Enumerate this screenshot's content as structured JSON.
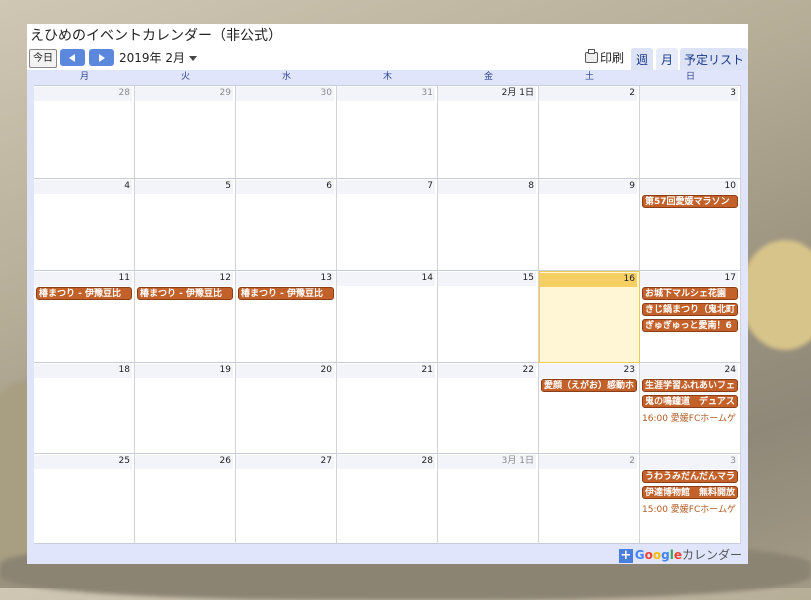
{
  "calendar": {
    "title": "えひめのイベントカレンダー（非公式）",
    "today_label": "今日",
    "current_date": "2019年 2月",
    "print_label": "印刷",
    "tabs": [
      "週",
      "月",
      "予定リスト"
    ],
    "weekdays": [
      "月",
      "火",
      "水",
      "木",
      "金",
      "土",
      "日"
    ],
    "weeks": [
      {
        "days": [
          {
            "label": "28",
            "other": true,
            "events": []
          },
          {
            "label": "29",
            "other": true,
            "events": []
          },
          {
            "label": "30",
            "other": true,
            "events": []
          },
          {
            "label": "31",
            "other": true,
            "events": []
          },
          {
            "label": "2月 1日",
            "other": false,
            "events": []
          },
          {
            "label": "2",
            "other": false,
            "events": []
          },
          {
            "label": "3",
            "other": false,
            "events": []
          }
        ]
      },
      {
        "days": [
          {
            "label": "4",
            "other": false,
            "events": []
          },
          {
            "label": "5",
            "other": false,
            "events": []
          },
          {
            "label": "6",
            "other": false,
            "events": []
          },
          {
            "label": "7",
            "other": false,
            "events": []
          },
          {
            "label": "8",
            "other": false,
            "events": []
          },
          {
            "label": "9",
            "other": false,
            "events": []
          },
          {
            "label": "10",
            "other": false,
            "events": [
              {
                "type": "bar",
                "text": "第57回愛媛マラソン"
              }
            ]
          }
        ]
      },
      {
        "days": [
          {
            "label": "11",
            "other": false,
            "events": [
              {
                "type": "bar",
                "text": "椿まつり - 伊豫豆比"
              }
            ]
          },
          {
            "label": "12",
            "other": false,
            "events": [
              {
                "type": "bar",
                "text": "椿まつり - 伊豫豆比"
              }
            ]
          },
          {
            "label": "13",
            "other": false,
            "events": [
              {
                "type": "bar",
                "text": "椿まつり - 伊豫豆比"
              }
            ]
          },
          {
            "label": "14",
            "other": false,
            "events": []
          },
          {
            "label": "15",
            "other": false,
            "events": []
          },
          {
            "label": "16",
            "other": false,
            "today": true,
            "events": []
          },
          {
            "label": "17",
            "other": false,
            "events": [
              {
                "type": "bar",
                "text": "お城下マルシェ花園"
              },
              {
                "type": "bar",
                "text": "きじ鍋まつり（鬼北町"
              },
              {
                "type": "bar",
                "text": "ぎゅぎゅっと愛南！6"
              }
            ]
          }
        ]
      },
      {
        "days": [
          {
            "label": "18",
            "other": false,
            "events": []
          },
          {
            "label": "19",
            "other": false,
            "events": []
          },
          {
            "label": "20",
            "other": false,
            "events": []
          },
          {
            "label": "21",
            "other": false,
            "events": []
          },
          {
            "label": "22",
            "other": false,
            "events": []
          },
          {
            "label": "23",
            "other": false,
            "events": [
              {
                "type": "bar",
                "text": "愛顔（えがお）感動ホ"
              }
            ]
          },
          {
            "label": "24",
            "other": false,
            "events": [
              {
                "type": "bar",
                "text": "生涯学習ふれあいフェ"
              },
              {
                "type": "bar",
                "text": "鬼の鳴鐘道　デュアス"
              },
              {
                "type": "time",
                "text": "16:00 愛媛FCホームゲ"
              }
            ]
          }
        ]
      },
      {
        "days": [
          {
            "label": "25",
            "other": false,
            "events": []
          },
          {
            "label": "26",
            "other": false,
            "events": []
          },
          {
            "label": "27",
            "other": false,
            "events": []
          },
          {
            "label": "28",
            "other": false,
            "events": []
          },
          {
            "label": "3月 1日",
            "other": true,
            "events": []
          },
          {
            "label": "2",
            "other": true,
            "events": []
          },
          {
            "label": "3",
            "other": true,
            "events": [
              {
                "type": "bar",
                "text": "うわうみだんだんマラ"
              },
              {
                "type": "bar",
                "text": "伊達博物館　無料開放"
              },
              {
                "type": "time",
                "text": "15:00 愛媛FCホームゲ"
              }
            ]
          }
        ]
      }
    ]
  },
  "footer": {
    "plus": "+",
    "brand": "Google",
    "label": "カレンダー"
  },
  "colors": {
    "event_bar": "#c3612a",
    "today_header": "#f5cf63",
    "nav_button": "#5b88dd"
  }
}
